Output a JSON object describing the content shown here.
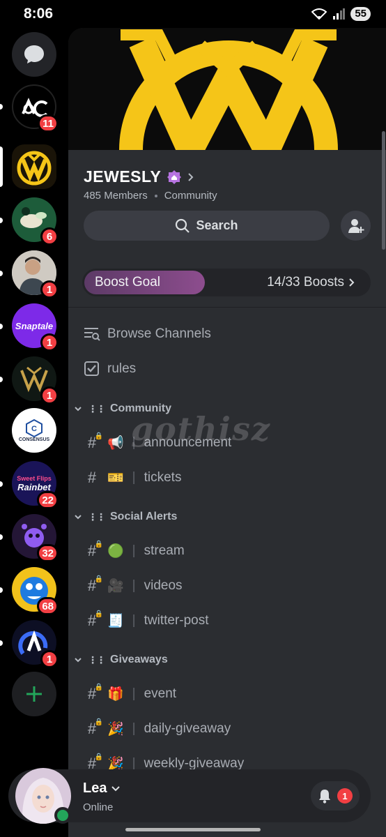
{
  "status_bar": {
    "time": "8:06",
    "battery": "55"
  },
  "rail": {
    "badges": [
      "11",
      "6",
      "1",
      "1",
      "1",
      "22",
      "32",
      "68",
      "1"
    ],
    "snaptale_label": "Snaptale",
    "consensus_label": "CONSENSUS",
    "sweetflips_label": "Sweet Flips",
    "rainbet_label": "Rainbet"
  },
  "server": {
    "name": "JEWESLY",
    "members": "485 Members",
    "type": "Community",
    "search_label": "Search",
    "boost_label": "Boost Goal",
    "boost_count": "14/33 Boosts",
    "boost_progress": 0.4242
  },
  "channels": {
    "browse": "Browse Channels",
    "rules": "rules",
    "categories": [
      {
        "name": "Community",
        "items": [
          {
            "emoji": "📢",
            "name": "announcement"
          },
          {
            "emoji": "🎫",
            "name": "tickets"
          }
        ]
      },
      {
        "name": "Social Alerts",
        "items": [
          {
            "emoji": "🟢",
            "name": "stream"
          },
          {
            "emoji": "🎥",
            "name": "videos"
          },
          {
            "emoji": "🧾",
            "name": "twitter-post"
          }
        ]
      },
      {
        "name": "Giveaways",
        "items": [
          {
            "emoji": "🎁",
            "name": "event"
          },
          {
            "emoji": "🎉",
            "name": "daily-giveaway"
          },
          {
            "emoji": "🎉",
            "name": "weekly-giveaway"
          }
        ]
      }
    ]
  },
  "watermark": "gothisz",
  "user": {
    "name": "Lea",
    "status": "Online",
    "notifications": "1"
  },
  "colors": {
    "accent_green": "#23a55a",
    "badge_red": "#f23f43",
    "boost_purple": "#8d4d8e",
    "banner_gold": "#f5c518"
  }
}
